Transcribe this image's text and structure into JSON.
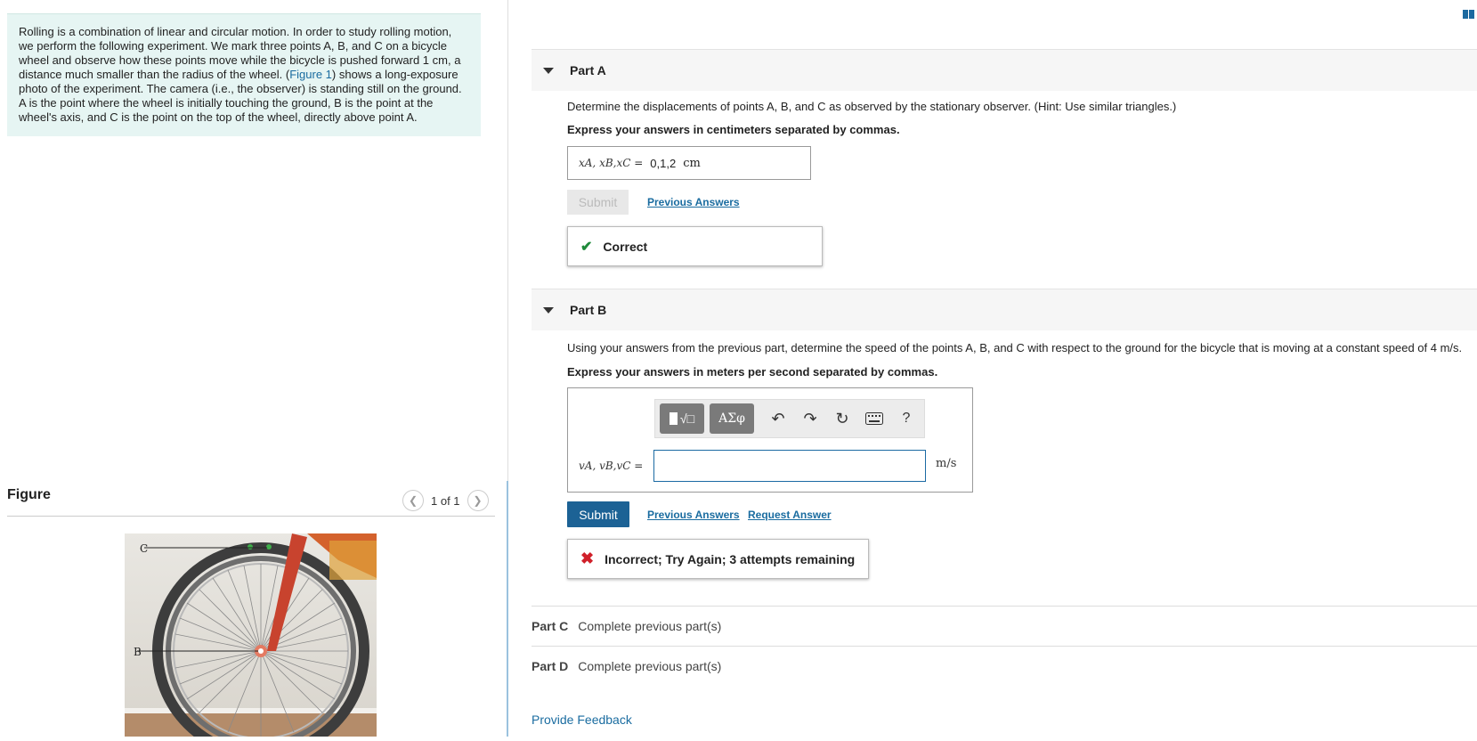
{
  "intro": {
    "text_before_link": "Rolling is a combination of linear and circular motion. In order to study rolling motion, we perform the following experiment. We mark three points A, B, and C on a bicycle wheel and observe how these points move while the bicycle is pushed forward 1 cm, a distance much smaller than the radius of the wheel. (",
    "link": "Figure 1",
    "text_after_link": ") shows a long-exposure photo of the experiment. The camera (i.e., the observer) is standing still on the ground. A is the point where the wheel is initially touching the ground, B is the point at the wheel's axis, and C is the point on the top of the wheel, directly above point A."
  },
  "figure": {
    "title": "Figure",
    "pager": "1 of 1",
    "label_c": "C",
    "label_b": "B"
  },
  "partA": {
    "title": "Part A",
    "question": "Determine the displacements of points A, B, and C as observed by the stationary observer. (Hint: Use similar triangles.)",
    "instruction": "Express your answers in centimeters separated by commas.",
    "lhs": "xA, xB,xC =",
    "answer": "0,1,2",
    "unit": "cm",
    "submit": "Submit",
    "previous_answers": "Previous Answers",
    "feedback": "Correct"
  },
  "partB": {
    "title": "Part B",
    "question": "Using your answers from the previous part, determine the speed of the points A, B, and C with respect to the ground for the bicycle that is moving at a constant speed of 4 m/s.",
    "instruction": "Express your answers in meters per second separated by commas.",
    "lhs": "vA, vB,vC =",
    "unit": "m/s",
    "toolbar": {
      "templates": "√□",
      "greek": "ΑΣφ",
      "help": "?"
    },
    "submit": "Submit",
    "previous_answers": "Previous Answers",
    "request_answer": "Request Answer",
    "feedback": "Incorrect; Try Again; 3 attempts remaining"
  },
  "partC": {
    "label": "Part C",
    "status": "Complete previous part(s)"
  },
  "partD": {
    "label": "Part D",
    "status": "Complete previous part(s)"
  },
  "provide_feedback": "Provide Feedback",
  "colors": {
    "accent": "#1c6295",
    "link": "#1a6ca0",
    "correct": "#1f8a3b",
    "incorrect": "#d0202a",
    "intro_bg": "#e6f5f3"
  }
}
